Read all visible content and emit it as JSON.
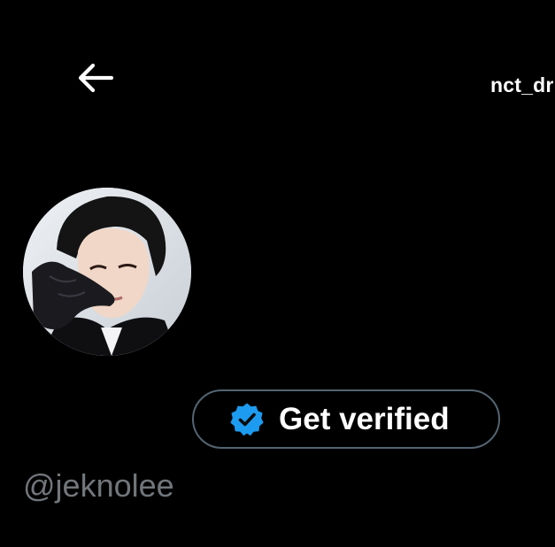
{
  "header": {
    "back_icon": "arrow-left-icon",
    "title": "nct_dr"
  },
  "profile": {
    "avatar": "profile-avatar-photo",
    "handle": "@jeknolee"
  },
  "verify_button": {
    "label": "Get verified",
    "icon": "verified-badge-icon",
    "badge_color": "#1d9bf0"
  },
  "colors": {
    "background": "#000000",
    "text_primary": "#ffffff",
    "text_secondary": "#71767b",
    "button_border": "#536471"
  }
}
